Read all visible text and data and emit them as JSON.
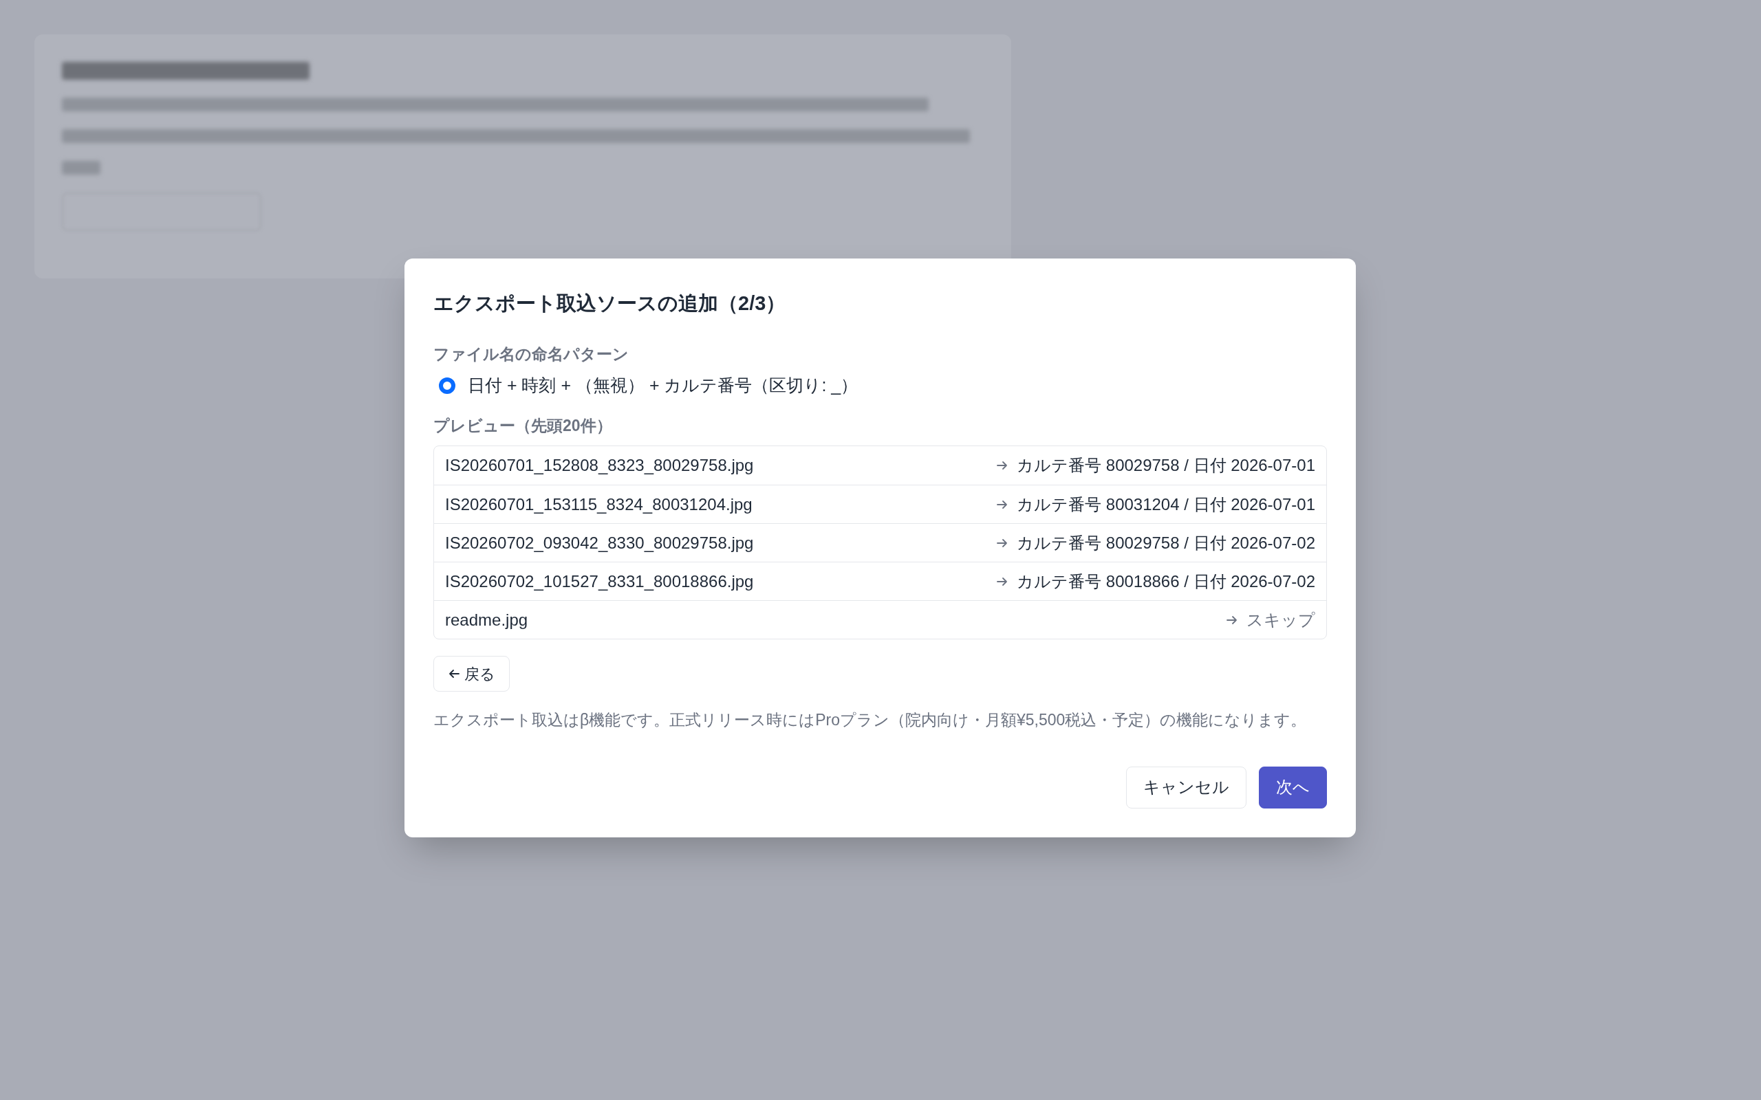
{
  "dialog": {
    "title": "エクスポート取込ソースの追加（2/3）",
    "pattern_label": "ファイル名の命名パターン",
    "pattern_options": [
      {
        "label": "日付 + 時刻 + （無視） + カルテ番号（区切り: _）",
        "selected": true
      }
    ],
    "preview_label": "プレビュー（先頭20件）",
    "preview_rows": [
      {
        "filename": "IS20260701_152808_8323_80029758.jpg",
        "result": "カルテ番号 80029758 / 日付 2026-07-01",
        "kind": "match"
      },
      {
        "filename": "IS20260701_153115_8324_80031204.jpg",
        "result": "カルテ番号 80031204 / 日付 2026-07-01",
        "kind": "match"
      },
      {
        "filename": "IS20260702_093042_8330_80029758.jpg",
        "result": "カルテ番号 80029758 / 日付 2026-07-02",
        "kind": "match"
      },
      {
        "filename": "IS20260702_101527_8331_80018866.jpg",
        "result": "カルテ番号 80018866 / 日付 2026-07-02",
        "kind": "match"
      },
      {
        "filename": "readme.jpg",
        "result": "スキップ",
        "kind": "skip"
      }
    ],
    "back_button": "戻る",
    "note": "エクスポート取込はβ機能です。正式リリース時にはProプラン（院内向け・月額¥5,500税込・予定）の機能になります。",
    "buttons": [
      {
        "label": "キャンセル",
        "kind": "secondary"
      },
      {
        "label": "次へ",
        "kind": "primary"
      }
    ]
  }
}
